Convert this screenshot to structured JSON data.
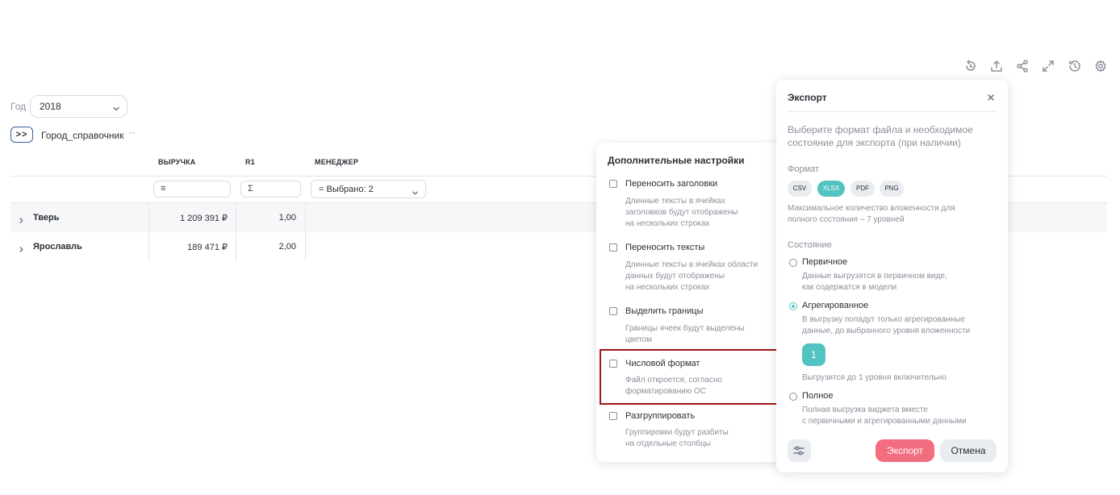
{
  "toolbar": {
    "icons": [
      "refresh-icon",
      "upload-icon",
      "share-icon",
      "fullscreen-icon",
      "history-icon",
      "gear-icon"
    ]
  },
  "filters": {
    "year_label": "Год",
    "year_value": "2018",
    "expand_label": ">>",
    "dimension_label": "Город_справочник",
    "dimension_more": "··"
  },
  "table": {
    "columns": [
      "ВЫРУЧКА",
      "R1",
      "МЕНЕДЖЕР"
    ],
    "filter_symbols": [
      "≡",
      "Σ"
    ],
    "manager_filter": "=  Выбрано: 2",
    "rows": [
      {
        "name": "Тверь",
        "revenue": "1 209 391 ₽",
        "r1": "1,00"
      },
      {
        "name": "Ярославль",
        "revenue": "189 471 ₽",
        "r1": "2,00"
      }
    ]
  },
  "settings_panel": {
    "title": "Дополнительные настройки",
    "options": [
      {
        "label": "Переносить заголовки",
        "desc": [
          "Длинные тексты в ячейках",
          "заголовков будут отображены",
          "на нескольких строках"
        ]
      },
      {
        "label": "Переносить тексты",
        "desc": [
          "Длинные тексты в ячейках области",
          "данных будут отображены",
          "на нескольких строках"
        ]
      },
      {
        "label": "Выделить границы",
        "desc": [
          "Границы ячеек будут выделены",
          "цветом"
        ]
      },
      {
        "label": "Числовой формат",
        "desc": [
          "Файл откроется, согласно",
          "форматированию ОС"
        ]
      },
      {
        "label": "Разгруппировать",
        "desc": [
          "Группировки будут разбиты",
          "на отдельные столбцы"
        ]
      }
    ]
  },
  "export_dialog": {
    "title": "Экспорт",
    "intro": "Выберите формат файла и необходимое состояние для экспорта (при наличии)",
    "format_label": "Формат",
    "formats": [
      "CSV",
      "XLSX",
      "PDF",
      "PNG"
    ],
    "selected_format": "XLSX",
    "format_note": [
      "Максимальное количество вложенности для",
      "полного состояния – 7 уровней"
    ],
    "state_label": "Состояние",
    "states": [
      {
        "label": "Первичное",
        "desc": [
          "Данные выгрузятся в первичном виде,",
          "как содержатся в модели"
        ]
      },
      {
        "label": "Агрегированное",
        "desc": [
          "В выгрузку попадут только агрегированные",
          "данные, до выбранного уровня вложенности"
        ]
      },
      {
        "label": "Полное",
        "desc": [
          "Полная выгрузка виджета вместе",
          "с первичными и агрегированными данными"
        ]
      }
    ],
    "selected_state": "Агрегированное",
    "level_value": "1",
    "level_note": "Выгрузится до 1 уровня включительно",
    "export_button": "Экспорт",
    "cancel_button": "Отмена"
  },
  "colors": {
    "accent": "#52c3c2",
    "export": "#f26d7f",
    "highlight": "#a3141c"
  }
}
